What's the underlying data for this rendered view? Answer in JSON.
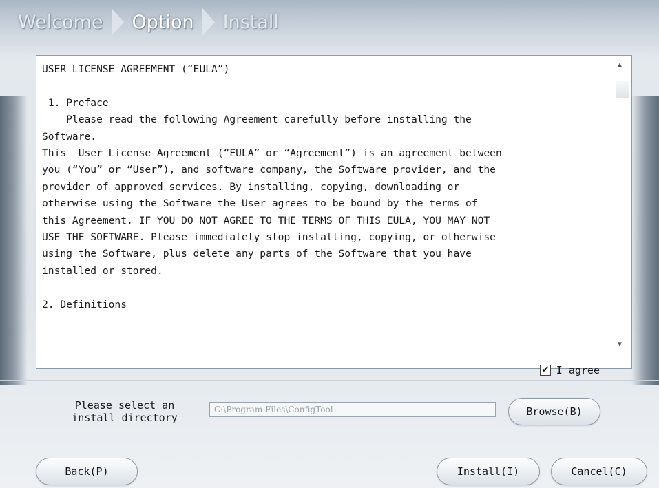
{
  "header": {
    "steps": [
      {
        "label": "Welcome"
      },
      {
        "label": "Option"
      },
      {
        "label": "Install"
      }
    ]
  },
  "eula": {
    "text": "USER LICENSE AGREEMENT (“EULA”)\n\n 1. Preface\n    Please read the following Agreement carefully before installing the\nSoftware.\nThis  User License Agreement (“EULA” or “Agreement”) is an agreement between\nyou (“You” or “User”), and software company, the Software provider, and the\nprovider of approved services. By installing, copying, downloading or\notherwise using the Software the User agrees to be bound by the terms of\nthis Agreement. IF YOU DO NOT AGREE TO THE TERMS OF THIS EULA, YOU MAY NOT\nUSE THE SOFTWARE. Please immediately stop installing, copying, or otherwise\nusing the Software, plus delete any parts of the Software that you have\ninstalled or stored.\n\n2. Definitions",
    "agree_label": "I agree",
    "agree_checked": true
  },
  "install_dir": {
    "label": "Please select an\ninstall directory",
    "value": "C:\\Program Files\\ConfigTool"
  },
  "buttons": {
    "browse": "Browse(B)",
    "back": "Back(P)",
    "install": "Install(I)",
    "cancel": "Cancel(C)"
  },
  "icons": {
    "scroll_up": "triangle-up",
    "scroll_down": "triangle-down",
    "checkmark": "check"
  }
}
